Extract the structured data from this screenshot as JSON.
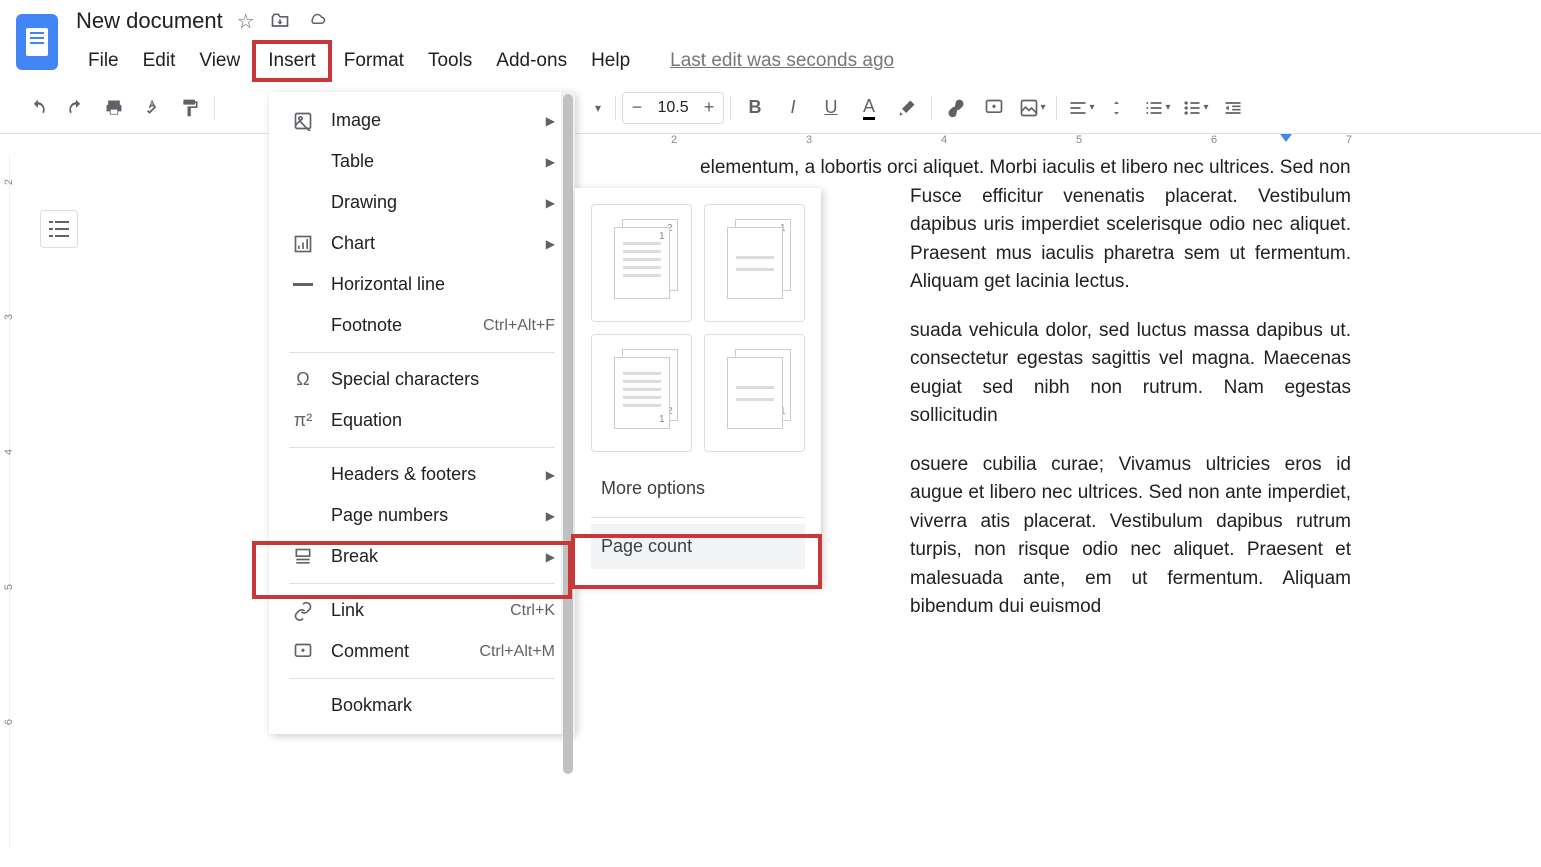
{
  "header": {
    "title": "New document",
    "last_edit": "Last edit was seconds ago"
  },
  "menubar": {
    "file": "File",
    "edit": "Edit",
    "view": "View",
    "insert": "Insert",
    "format": "Format",
    "tools": "Tools",
    "addons": "Add-ons",
    "help": "Help"
  },
  "toolbar": {
    "font_size": "10.5"
  },
  "insert_menu": {
    "image": "Image",
    "table": "Table",
    "drawing": "Drawing",
    "chart": "Chart",
    "horizontal_line": "Horizontal line",
    "footnote": "Footnote",
    "footnote_shortcut": "Ctrl+Alt+F",
    "special_chars": "Special characters",
    "equation": "Equation",
    "headers_footers": "Headers & footers",
    "page_numbers": "Page numbers",
    "break": "Break",
    "link": "Link",
    "link_shortcut": "Ctrl+K",
    "comment": "Comment",
    "comment_shortcut": "Ctrl+Alt+M",
    "bookmark": "Bookmark"
  },
  "page_numbers_submenu": {
    "more_options": "More options",
    "page_count": "Page count"
  },
  "ruler": {
    "h": [
      "2",
      "3",
      "4",
      "5",
      "6",
      "7"
    ],
    "v": [
      "2",
      "3",
      "4",
      "5",
      "6"
    ]
  },
  "document": {
    "p1": "elementum, a lobortis orci aliquet. Morbi iaculis et libero nec ultrices. Sed non",
    "p2": "Fusce efficitur venenatis placerat. Vestibulum dapibus uris imperdiet scelerisque odio nec aliquet. Praesent mus iaculis pharetra sem ut fermentum. Aliquam get lacinia lectus.",
    "p3": "suada vehicula dolor, sed luctus massa dapibus ut. consectetur egestas sagittis vel magna. Maecenas eugiat sed nibh non rutrum. Nam egestas sollicitudin",
    "p4": "osuere cubilia curae; Vivamus ultricies eros id augue et libero nec ultrices. Sed non ante imperdiet, viverra atis placerat. Vestibulum dapibus rutrum turpis, non risque odio nec aliquet. Praesent et malesuada ante, em ut fermentum. Aliquam bibendum dui euismod"
  }
}
